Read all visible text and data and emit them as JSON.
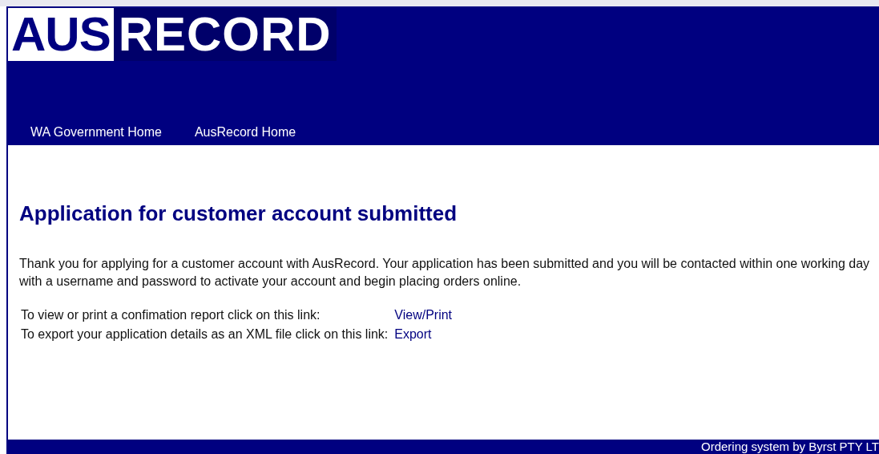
{
  "logo": {
    "part_1": "AUS",
    "part_2": "RECORD"
  },
  "nav": [
    "WA Government Home",
    "AusRecord Home"
  ],
  "heading": "Application for customer account submitted",
  "message": "Thank you for applying for a customer account with AusRecord. Your application has been submitted and you will be contacted within one working day with a username and password to activate your account and begin placing orders online.",
  "links": [
    {
      "label": "To view or print a confimation report click on this link:",
      "link": "View/Print"
    },
    {
      "label": "To export your application details as an XML file click on this link:",
      "link": "Export"
    }
  ],
  "footer": "Ordering system by Byrst PTY LT"
}
